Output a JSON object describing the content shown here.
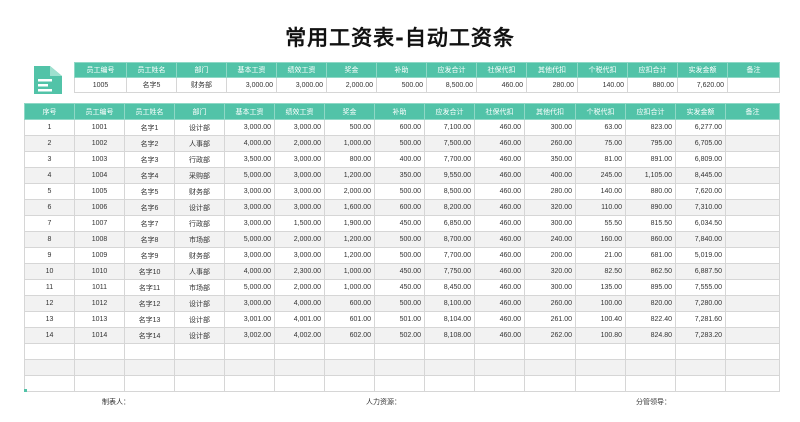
{
  "title": "常用工资表-自动工资条",
  "colors": {
    "header_bg": "#52c3a8",
    "alt_row": "#f2f2f2",
    "logo": "#52c3a8"
  },
  "slip": {
    "headers": [
      "员工编号",
      "员工姓名",
      "部门",
      "基本工资",
      "绩效工资",
      "奖金",
      "补助",
      "应发合计",
      "社保代扣",
      "其他代扣",
      "个税代扣",
      "应扣合计",
      "实发金额",
      "备注"
    ],
    "row": [
      "1005",
      "名字5",
      "财务部",
      "3,000.00",
      "3,000.00",
      "2,000.00",
      "500.00",
      "8,500.00",
      "460.00",
      "280.00",
      "140.00",
      "880.00",
      "7,620.00",
      ""
    ]
  },
  "main": {
    "headers": [
      "序号",
      "员工编号",
      "员工姓名",
      "部门",
      "基本工资",
      "绩效工资",
      "奖金",
      "补助",
      "应发合计",
      "社保代扣",
      "其他代扣",
      "个税代扣",
      "应扣合计",
      "实发金额",
      "备注"
    ],
    "rows": [
      [
        "1",
        "1001",
        "名字1",
        "设计部",
        "3,000.00",
        "3,000.00",
        "500.00",
        "600.00",
        "7,100.00",
        "460.00",
        "300.00",
        "63.00",
        "823.00",
        "6,277.00",
        ""
      ],
      [
        "2",
        "1002",
        "名字2",
        "人事部",
        "4,000.00",
        "2,000.00",
        "1,000.00",
        "500.00",
        "7,500.00",
        "460.00",
        "260.00",
        "75.00",
        "795.00",
        "6,705.00",
        ""
      ],
      [
        "3",
        "1003",
        "名字3",
        "行政部",
        "3,500.00",
        "3,000.00",
        "800.00",
        "400.00",
        "7,700.00",
        "460.00",
        "350.00",
        "81.00",
        "891.00",
        "6,809.00",
        ""
      ],
      [
        "4",
        "1004",
        "名字4",
        "采购部",
        "5,000.00",
        "3,000.00",
        "1,200.00",
        "350.00",
        "9,550.00",
        "460.00",
        "400.00",
        "245.00",
        "1,105.00",
        "8,445.00",
        ""
      ],
      [
        "5",
        "1005",
        "名字5",
        "财务部",
        "3,000.00",
        "3,000.00",
        "2,000.00",
        "500.00",
        "8,500.00",
        "460.00",
        "280.00",
        "140.00",
        "880.00",
        "7,620.00",
        ""
      ],
      [
        "6",
        "1006",
        "名字6",
        "设计部",
        "3,000.00",
        "3,000.00",
        "1,600.00",
        "600.00",
        "8,200.00",
        "460.00",
        "320.00",
        "110.00",
        "890.00",
        "7,310.00",
        ""
      ],
      [
        "7",
        "1007",
        "名字7",
        "行政部",
        "3,000.00",
        "1,500.00",
        "1,900.00",
        "450.00",
        "6,850.00",
        "460.00",
        "300.00",
        "55.50",
        "815.50",
        "6,034.50",
        ""
      ],
      [
        "8",
        "1008",
        "名字8",
        "市场部",
        "5,000.00",
        "2,000.00",
        "1,200.00",
        "500.00",
        "8,700.00",
        "460.00",
        "240.00",
        "160.00",
        "860.00",
        "7,840.00",
        ""
      ],
      [
        "9",
        "1009",
        "名字9",
        "财务部",
        "3,000.00",
        "3,000.00",
        "1,200.00",
        "500.00",
        "7,700.00",
        "460.00",
        "200.00",
        "21.00",
        "681.00",
        "5,019.00",
        ""
      ],
      [
        "10",
        "1010",
        "名字10",
        "人事部",
        "4,000.00",
        "2,300.00",
        "1,000.00",
        "450.00",
        "7,750.00",
        "460.00",
        "320.00",
        "82.50",
        "862.50",
        "6,887.50",
        ""
      ],
      [
        "11",
        "1011",
        "名字11",
        "市场部",
        "5,000.00",
        "2,000.00",
        "1,000.00",
        "450.00",
        "8,450.00",
        "460.00",
        "300.00",
        "135.00",
        "895.00",
        "7,555.00",
        ""
      ],
      [
        "12",
        "1012",
        "名字12",
        "设计部",
        "3,000.00",
        "4,000.00",
        "600.00",
        "500.00",
        "8,100.00",
        "460.00",
        "260.00",
        "100.00",
        "820.00",
        "7,280.00",
        ""
      ],
      [
        "13",
        "1013",
        "名字13",
        "设计部",
        "3,001.00",
        "4,001.00",
        "601.00",
        "501.00",
        "8,104.00",
        "460.00",
        "261.00",
        "100.40",
        "822.40",
        "7,281.60",
        ""
      ],
      [
        "14",
        "1014",
        "名字14",
        "设计部",
        "3,002.00",
        "4,002.00",
        "602.00",
        "502.00",
        "8,108.00",
        "460.00",
        "262.00",
        "100.80",
        "824.80",
        "7,283.20",
        ""
      ]
    ],
    "empty_rows": 3
  },
  "footer": {
    "preparer": "制表人：",
    "hr": "人力资源：",
    "supervisor": "分管领导："
  }
}
